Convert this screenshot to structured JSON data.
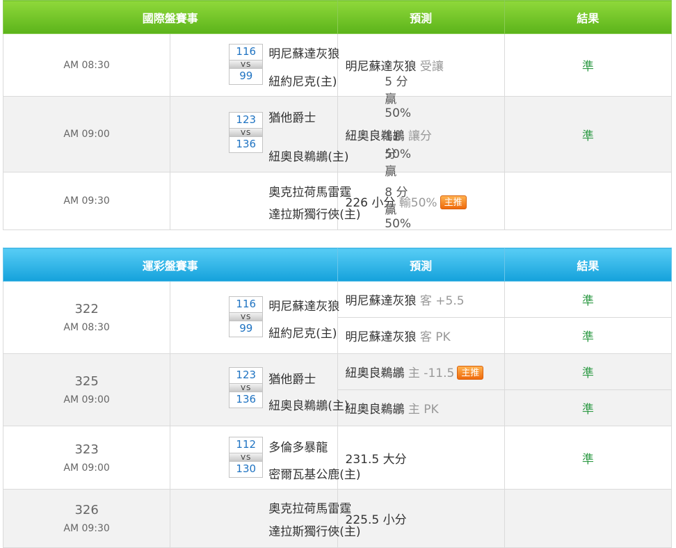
{
  "intl": {
    "header": {
      "title": "國際盤賽事",
      "pred": "預測",
      "result": "結果"
    },
    "rows": [
      {
        "time": "AM 08:30",
        "score_away": "116",
        "score_home": "99",
        "vs": "VS",
        "away": "明尼蘇達灰狼",
        "home": "紐約尼克(主)",
        "handicap_1": "5 分贏50%",
        "handicap_2": "",
        "pred_team": "明尼蘇達灰狼",
        "pred_note": "受讓",
        "badge": "",
        "result": "準"
      },
      {
        "time": "AM 09:00",
        "score_away": "123",
        "score_home": "136",
        "vs": "VS",
        "away": "猶他爵士",
        "home": "紐奧良鵜鶘(主)",
        "handicap_1": "11 分贏",
        "handicap_2": "50%",
        "pred_team": "紐奧良鵜鶘",
        "pred_note": "讓分",
        "badge": "",
        "result": "準"
      },
      {
        "time": "AM 09:30",
        "away": "奧克拉荷馬雷霆",
        "home": "達拉斯獨行俠(主)",
        "handicap_1": "8 分贏50%",
        "pred_team": "226 小分",
        "pred_note": "輸50%",
        "badge": "主推",
        "result": ""
      }
    ]
  },
  "sports": {
    "header": {
      "title": "運彩盤賽事",
      "pred": "預測",
      "result": "結果"
    },
    "games": [
      {
        "no": "322",
        "time": "AM 08:30",
        "score_away": "116",
        "score_home": "99",
        "vs": "VS",
        "away": "明尼蘇達灰狼",
        "home": "紐約尼克(主)",
        "preds": [
          {
            "team": "明尼蘇達灰狼",
            "note": "客 +5.5",
            "badge": "",
            "result": "準"
          },
          {
            "team": "明尼蘇達灰狼",
            "note": "客 PK",
            "badge": "",
            "result": "準"
          }
        ]
      },
      {
        "no": "325",
        "time": "AM 09:00",
        "score_away": "123",
        "score_home": "136",
        "vs": "VS",
        "away": "猶他爵士",
        "home": "紐奧良鵜鶘(主)",
        "preds": [
          {
            "team": "紐奧良鵜鶘",
            "note": "主 -11.5",
            "badge": "主推",
            "result": "準"
          },
          {
            "team": "紐奧良鵜鶘",
            "note": "主 PK",
            "badge": "",
            "result": "準"
          }
        ]
      },
      {
        "no": "323",
        "time": "AM 09:00",
        "score_away": "112",
        "score_home": "130",
        "vs": "VS",
        "away": "多倫多暴龍",
        "home": "密爾瓦基公鹿(主)",
        "preds": [
          {
            "team": "231.5 大分",
            "note": "",
            "badge": "",
            "result": "準"
          }
        ]
      },
      {
        "no": "326",
        "time": "AM 09:30",
        "away": "奧克拉荷馬雷霆",
        "home": "達拉斯獨行俠(主)",
        "preds": [
          {
            "team": "225.5 小分",
            "note": "",
            "badge": "",
            "result": ""
          }
        ]
      }
    ]
  }
}
